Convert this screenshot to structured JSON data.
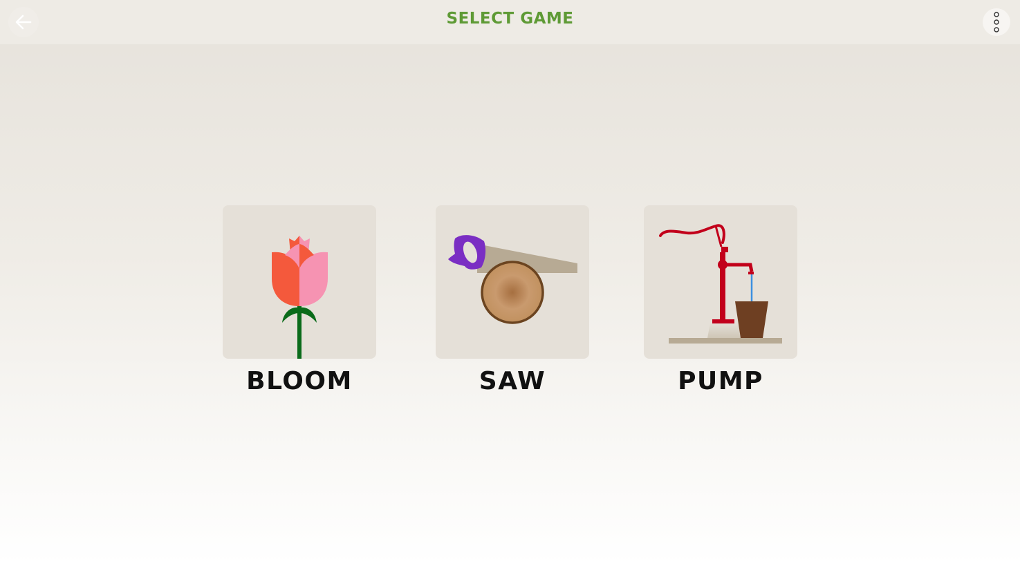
{
  "header": {
    "title": "SELECT GAME",
    "back_icon": "arrow-left-icon",
    "menu_icon": "more-vertical-icon"
  },
  "games": [
    {
      "label": "BLOOM",
      "icon": "tulip-icon"
    },
    {
      "label": "SAW",
      "icon": "hand-saw-log-icon"
    },
    {
      "label": "PUMP",
      "icon": "water-pump-icon"
    }
  ],
  "colors": {
    "title": "#5e9a35",
    "tile_bg": "#e5e0d8",
    "header_bg": "#eeebe5"
  }
}
